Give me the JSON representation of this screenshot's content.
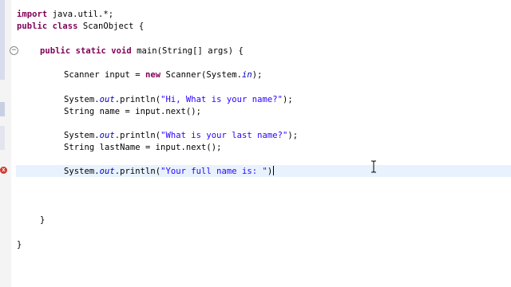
{
  "editor": {
    "lines": {
      "l1": {
        "kw1": "import",
        "t1": " java.util.*;"
      },
      "l2": {
        "kw1": "public",
        "t1": " ",
        "kw2": "class",
        "t2": " ScanObject {"
      },
      "l3": {
        "kw1": "public",
        "t1": " ",
        "kw2": "static",
        "t2": " ",
        "kw3": "void",
        "t3": " main(String[] args) {"
      },
      "l4": {
        "t1": "Scanner input = ",
        "kw1": "new",
        "t2": " Scanner(System.",
        "f1": "in",
        "t3": ");"
      },
      "l5": {
        "t1": "System.",
        "f1": "out",
        "t2": ".println(",
        "s1": "\"Hi, What is your name?\"",
        "t3": ");"
      },
      "l6": {
        "t1": "String name = input.next();"
      },
      "l7": {
        "t1": "System.",
        "f1": "out",
        "t2": ".println(",
        "s1": "\"What is your last name?\"",
        "t3": ");"
      },
      "l8": {
        "t1": "String lastName = input.next();"
      },
      "l9": {
        "t1": "System.",
        "f1": "out",
        "t2": ".println(",
        "s1": "\"Your full name is: \"",
        "t3": ")"
      },
      "l10": {
        "t1": "}"
      },
      "l11": {
        "t1": "}"
      }
    },
    "fold_marker": "−",
    "error_marker": "x"
  },
  "colors": {
    "keyword": "#7f0055",
    "string": "#2a00ff",
    "field": "#0000c0",
    "current_line": "#e8f2fe",
    "error": "#d63a2f"
  },
  "icons": {
    "fold": "collapse-icon",
    "error": "error-icon",
    "mouse": "ibeam-cursor-icon"
  }
}
